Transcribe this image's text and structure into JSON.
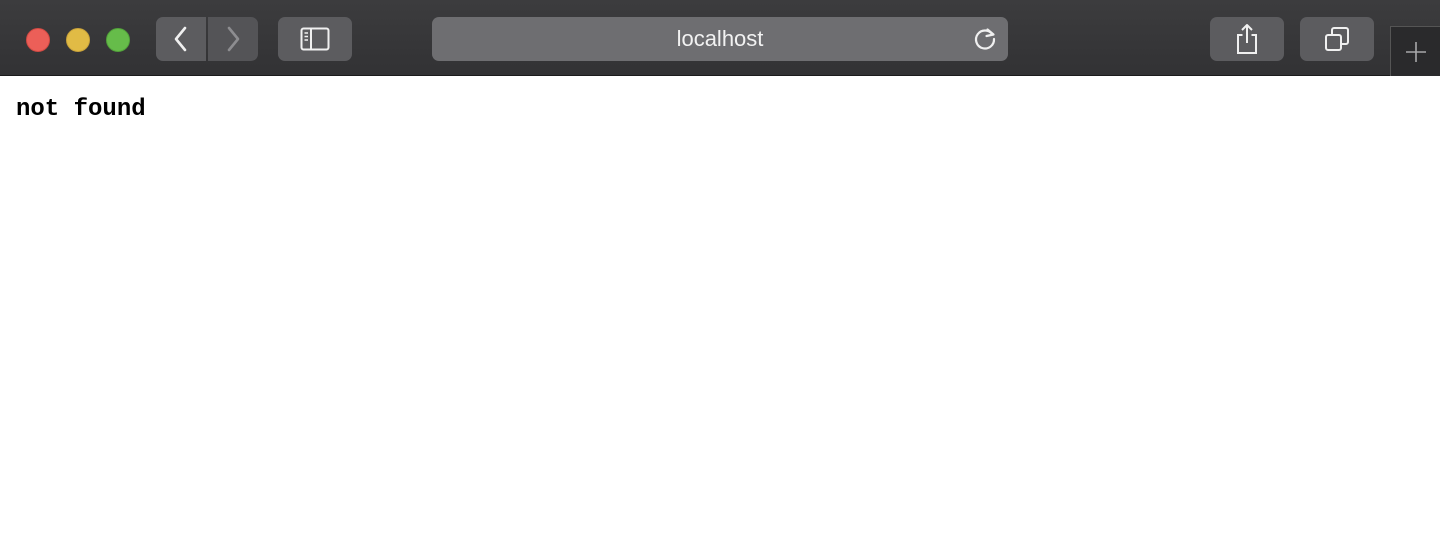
{
  "browser": {
    "address_bar": {
      "url_text": "localhost"
    },
    "toolbar": {
      "back_icon": "chevron-left-icon",
      "forward_icon": "chevron-right-icon",
      "sidebar_icon": "sidebar-icon",
      "share_icon": "share-icon",
      "tabs_icon": "tab-overview-icon",
      "reload_icon": "reload-icon",
      "new_tab_icon": "plus-icon"
    },
    "colors": {
      "close": "#ec5f58",
      "minimize": "#e1bb45",
      "zoom": "#66bc4a"
    }
  },
  "page": {
    "body_text": "not found"
  }
}
